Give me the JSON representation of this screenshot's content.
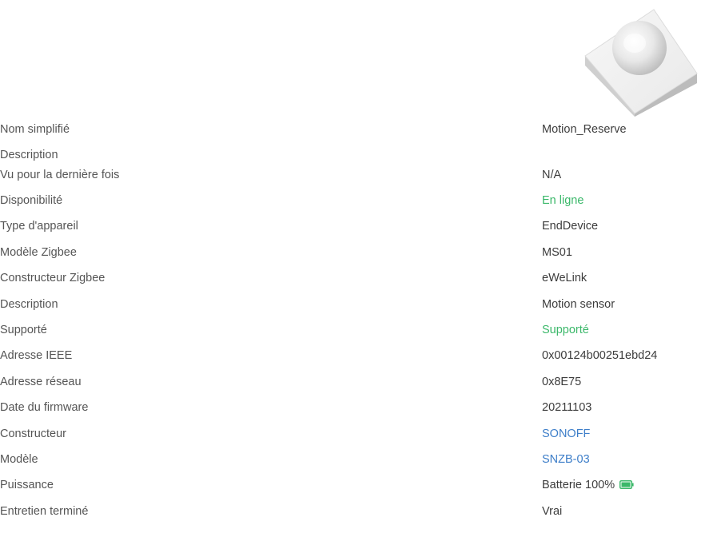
{
  "device_image": {
    "icon": "motion-sensor-image"
  },
  "rows": [
    {
      "label": "Nom simplifié",
      "value": "Motion_Reserve"
    },
    {
      "label": "Description",
      "value": ""
    },
    {
      "label": "Vu pour la dernière fois",
      "value": "N/A"
    },
    {
      "label": "Disponibilité",
      "value": "En ligne"
    },
    {
      "label": "Type d'appareil",
      "value": "EndDevice"
    },
    {
      "label": "Modèle Zigbee",
      "value": "MS01"
    },
    {
      "label": "Constructeur Zigbee",
      "value": "eWeLink"
    },
    {
      "label": "Description",
      "value": "Motion sensor"
    },
    {
      "label": "Supporté",
      "value": "Supporté"
    },
    {
      "label": "Adresse IEEE",
      "value": "0x00124b00251ebd24"
    },
    {
      "label": "Adresse réseau",
      "value": "0x8E75"
    },
    {
      "label": "Date du firmware",
      "value": "20211103"
    },
    {
      "label": "Constructeur",
      "value": "SONOFF"
    },
    {
      "label": "Modèle",
      "value": "SNZB-03"
    },
    {
      "label": "Puissance",
      "value": "Batterie 100%",
      "battery_level": 1.0,
      "icon": "battery-full-icon"
    },
    {
      "label": "Entretien terminé",
      "value": "Vrai"
    }
  ],
  "colors": {
    "online": "#3bb86a",
    "link": "#3d7ec9",
    "battery": "#3bb86a"
  }
}
